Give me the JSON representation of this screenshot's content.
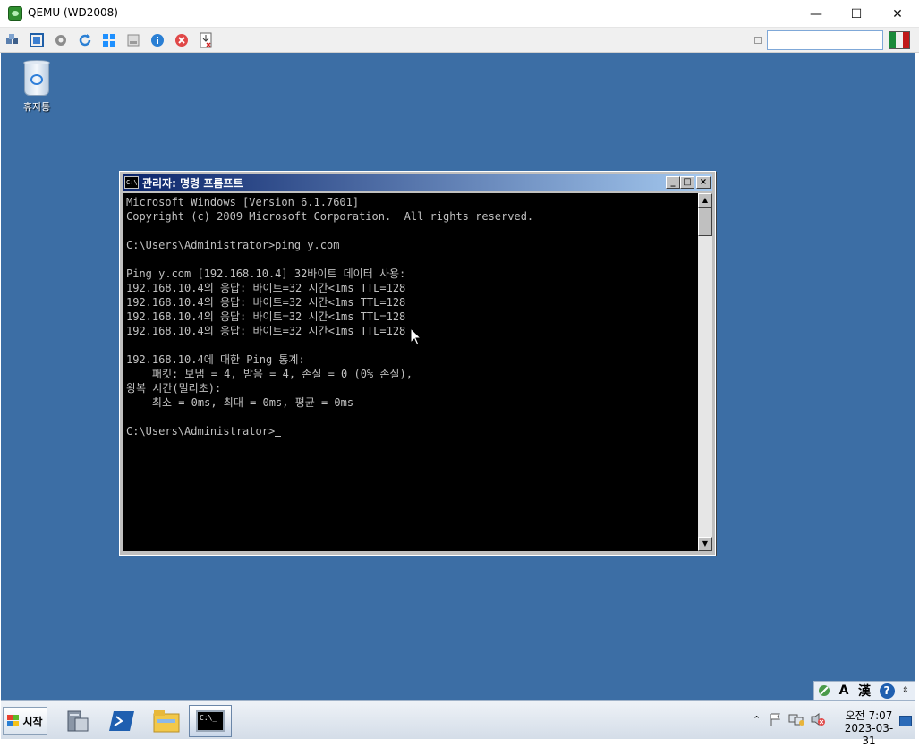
{
  "host_window": {
    "title": "QEMU (WD2008)",
    "minimize_glyph": "—",
    "maximize_glyph": "☐",
    "close_glyph": "✕"
  },
  "toolbar": {
    "icons": [
      "cubes-icon",
      "fullscreen-icon",
      "gear-icon",
      "refresh-icon",
      "windows-icon",
      "drive-icon",
      "info-icon",
      "stop-icon",
      "remove-device-icon"
    ],
    "search_value": ""
  },
  "desktop": {
    "background": "#3c6ea5",
    "recycle_bin_label": "휴지통"
  },
  "cmd_window": {
    "title": "관리자: 명령 프롬프트",
    "icon_text": "C:\\",
    "lines": [
      "Microsoft Windows [Version 6.1.7601]",
      "Copyright (c) 2009 Microsoft Corporation.  All rights reserved.",
      "",
      "C:\\Users\\Administrator>ping y.com",
      "",
      "Ping y.com [192.168.10.4] 32바이트 데이터 사용:",
      "192.168.10.4의 응답: 바이트=32 시간<1ms TTL=128",
      "192.168.10.4의 응답: 바이트=32 시간<1ms TTL=128",
      "192.168.10.4의 응답: 바이트=32 시간<1ms TTL=128",
      "192.168.10.4의 응답: 바이트=32 시간<1ms TTL=128",
      "",
      "192.168.10.4에 대한 Ping 통계:",
      "    패킷: 보냄 = 4, 받음 = 4, 손실 = 0 (0% 손실),",
      "왕복 시간(밀리초):",
      "    최소 = 0ms, 최대 = 0ms, 평균 = 0ms",
      "",
      "C:\\Users\\Administrator>"
    ]
  },
  "language_bar": {
    "ime_label": "A",
    "hanja_label": "漢",
    "help_label": "?"
  },
  "taskbar": {
    "start_label": "시작",
    "apps": [
      "server-manager-icon",
      "powershell-icon",
      "explorer-icon",
      "cmd-icon"
    ],
    "active_app_text": "C:\\_",
    "clock_time": "오전 7:07",
    "clock_date": "2023-03-31"
  }
}
